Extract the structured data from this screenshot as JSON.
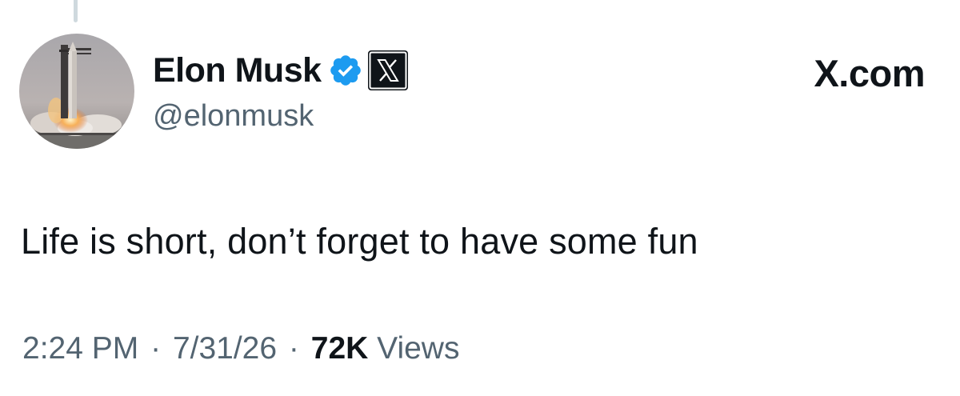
{
  "tweet": {
    "author": {
      "display_name": "Elon Musk",
      "handle": "@elonmusk",
      "verified_icon": "verified-badge-icon",
      "affiliation_icon": "x-logo-icon"
    },
    "brand_label": "X.com",
    "text": "Life is short, don’t forget to have some fun",
    "meta": {
      "time": "2:24 PM",
      "separator": "·",
      "date": "7/31/26",
      "view_count": "72K",
      "views_label": "Views"
    }
  },
  "colors": {
    "text_primary": "#0f1419",
    "text_secondary": "#536471",
    "verified_blue": "#1d9bf0",
    "thread_line": "#cfd9de"
  }
}
